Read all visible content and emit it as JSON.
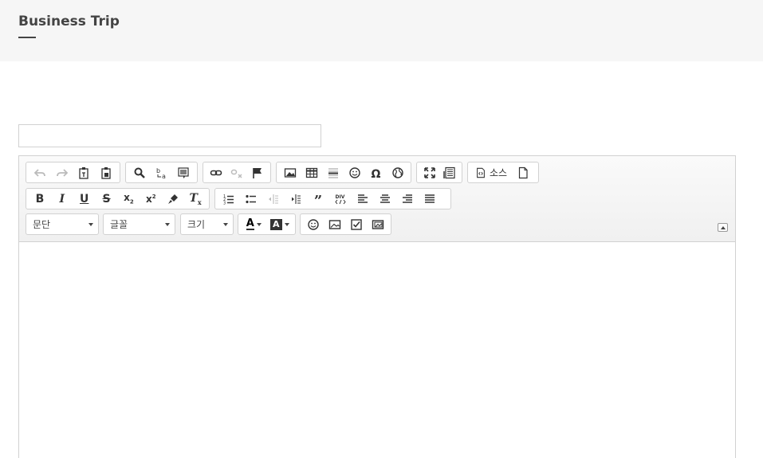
{
  "header": {
    "title": "Business Trip"
  },
  "title_input": {
    "value": "",
    "placeholder": ""
  },
  "toolbar": {
    "row1": {
      "group1": [
        "undo-icon",
        "redo-icon",
        "paste-text-icon",
        "paste-word-icon"
      ],
      "group2": [
        "find-icon",
        "replace-icon",
        "select-all-icon"
      ],
      "group3": [
        "link-icon",
        "unlink-icon",
        "anchor-icon"
      ],
      "group4": [
        "image-icon",
        "table-icon",
        "horizontal-rule-icon",
        "smiley-icon",
        "special-char-icon",
        "iframe-icon"
      ],
      "group5": [
        "maximize-icon",
        "show-blocks-icon"
      ],
      "source_label": "소스",
      "new_page": "new-page-icon"
    },
    "row2": {
      "group1": [
        "bold-icon",
        "italic-icon",
        "underline-icon",
        "strike-icon",
        "subscript-icon",
        "superscript-icon",
        "copy-format-icon",
        "remove-format-icon"
      ],
      "group2": [
        "numbered-list-icon",
        "bulleted-list-icon",
        "outdent-icon",
        "indent-icon",
        "blockquote-icon",
        "div-icon",
        "align-left-icon",
        "align-center-icon",
        "align-right-icon",
        "justify-icon"
      ]
    },
    "row3": {
      "format_label": "문단",
      "font_label": "글꼴",
      "size_label": "크기",
      "text_color_glyph": "A",
      "bg_color_glyph": "A",
      "group_extra": [
        "emoji-icon",
        "image2-icon",
        "checkbox-icon",
        "image3-icon"
      ]
    }
  },
  "colors": {
    "header_bg": "#f6f6f6",
    "border": "#d1d1d1",
    "icon": "#333333",
    "disabled_icon": "#bbbbbb"
  }
}
